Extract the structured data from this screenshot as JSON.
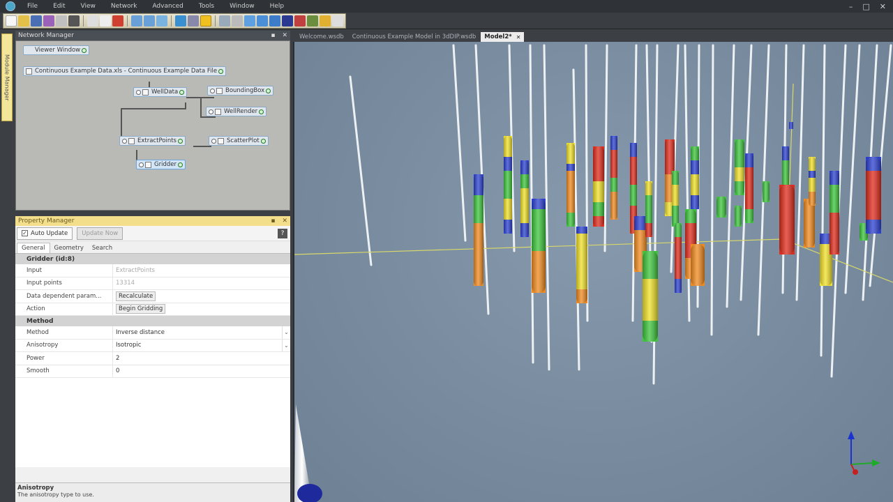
{
  "menubar": {
    "items": [
      "File",
      "Edit",
      "View",
      "Network",
      "Advanced",
      "Tools",
      "Window",
      "Help"
    ],
    "window_controls": [
      "–",
      "□",
      "✕"
    ]
  },
  "module_manager": {
    "label": "Module Manager"
  },
  "network_manager": {
    "title": "Network Manager",
    "nodes": {
      "viewer": "Viewer Window",
      "data_file": "Continuous Example Data.xls - Continuous Example Data File",
      "welldata": "WellData",
      "boundingbox": "BoundingBox",
      "wellrender": "WellRender",
      "extractpoints": "ExtractPoints",
      "scatterplot": "ScatterPlot",
      "gridder": "Gridder"
    }
  },
  "property_manager": {
    "title": "Property Manager",
    "auto_update": "Auto Update",
    "update_now": "Update Now",
    "help": "?",
    "tabs": [
      "General",
      "Geometry",
      "Search"
    ],
    "sections": {
      "gridder": {
        "header": "Gridder (id:8)",
        "rows": [
          {
            "name": "Input",
            "value": "ExtractPoints"
          },
          {
            "name": "Input points",
            "value": "13314"
          },
          {
            "name": "Data dependent param...",
            "value": "Recalculate"
          },
          {
            "name": "Action",
            "value": "Begin Gridding"
          }
        ]
      },
      "method": {
        "header": "Method",
        "rows": [
          {
            "name": "Method",
            "value": "Inverse distance"
          },
          {
            "name": "Anisotropy",
            "value": "Isotropic"
          },
          {
            "name": "Power",
            "value": "2"
          },
          {
            "name": "Smooth",
            "value": "0"
          }
        ]
      }
    },
    "description": {
      "title": "Anisotropy",
      "text": "The anisotropy type to use."
    }
  },
  "doc_tabs": [
    {
      "label": "Welcome.wsdb"
    },
    {
      "label": "Continuous Example Model in 3dDIP.wsdb"
    },
    {
      "label": "Model2*"
    }
  ],
  "colors": {
    "accent_yellow": "#f3df8b",
    "viewer_bg": "#7a8ca0",
    "well_red": "#e02b1b",
    "well_orange": "#f08a1e",
    "well_yellow": "#f0e028",
    "well_green": "#3cc43a",
    "well_blue": "#2a3fd0"
  }
}
